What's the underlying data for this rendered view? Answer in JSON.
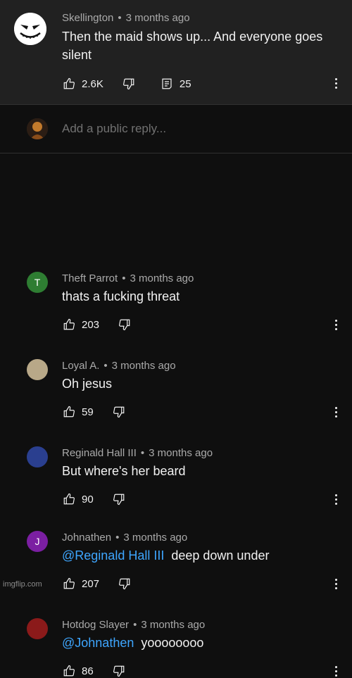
{
  "top_comment": {
    "author": "Skellington",
    "time": "3 months ago",
    "text": "Then the maid shows up... And everyone goes silent",
    "likes": "2.6K",
    "replies": "25"
  },
  "reply_box": {
    "placeholder": "Add a public reply..."
  },
  "replies": [
    {
      "author": "Theft Parrot",
      "time": "3 months ago",
      "mention": "",
      "text": "thats a fucking threat",
      "likes": "203",
      "avatar_letter": "T",
      "avatar_color": "#2e7d32"
    },
    {
      "author": "Loyal A.",
      "time": "3 months ago",
      "mention": "",
      "text": "Oh jesus",
      "likes": "59",
      "avatar_letter": "",
      "avatar_color": "#b8a888"
    },
    {
      "author": "Reginald Hall III",
      "time": "3 months ago",
      "mention": "",
      "text": "But where's her beard",
      "likes": "90",
      "avatar_letter": "",
      "avatar_color": "#2a3f8f"
    },
    {
      "author": "Johnathen",
      "time": "3 months ago",
      "mention": "@Reginald Hall III",
      "text": "deep down under",
      "likes": "207",
      "avatar_letter": "J",
      "avatar_color": "#7b1fa2"
    },
    {
      "author": "Hotdog Slayer",
      "time": "3 months ago",
      "mention": "@Johnathen",
      "text": "yoooooooo",
      "likes": "86",
      "avatar_letter": "",
      "avatar_color": "#8b1a1a"
    }
  ],
  "watermark": "imgflip.com",
  "colors": {
    "background": "#0f0f0f",
    "top_background": "#212121",
    "mention": "#3ea6ff",
    "meta": "#aaaaaa"
  }
}
